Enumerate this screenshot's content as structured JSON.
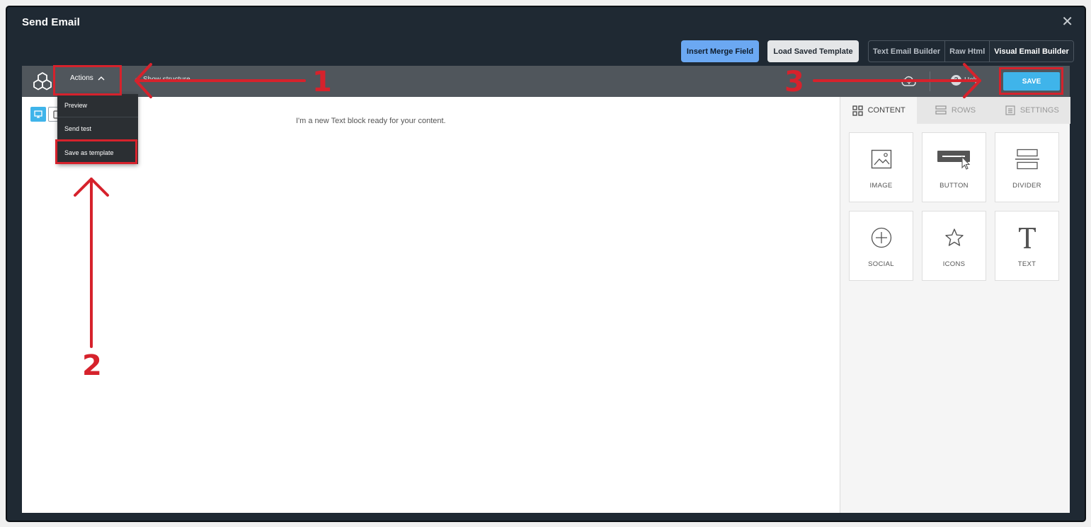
{
  "window": {
    "title": "Send Email",
    "close_glyph": "✕"
  },
  "topbar": {
    "insert_merge_field": "Insert Merge Field",
    "load_saved_template": "Load Saved Template",
    "modes": [
      "Text Email Builder",
      "Raw Html",
      "Visual Email Builder"
    ],
    "active_mode": "Visual Email Builder"
  },
  "toolbar": {
    "logo_icon": "cubes-logo-icon",
    "actions_label": "Actions",
    "show_structure_label": "Show structure",
    "help_label": "Help",
    "save_label": "SAVE"
  },
  "actions_menu": {
    "items": [
      "Preview",
      "Send test",
      "Save as template"
    ],
    "highlighted": "Save as template"
  },
  "canvas": {
    "text_block": "I'm a new Text block ready for your content.",
    "device_icons": [
      "desktop-icon",
      "mobile-icon"
    ]
  },
  "sidebar": {
    "tabs": [
      {
        "label": "CONTENT",
        "icon": "grid-icon"
      },
      {
        "label": "ROWS",
        "icon": "rows-icon"
      },
      {
        "label": "SETTINGS",
        "icon": "settings-icon"
      }
    ],
    "active_tab": "CONTENT",
    "tiles": [
      {
        "label": "IMAGE",
        "icon": "image-icon"
      },
      {
        "label": "BUTTON",
        "icon": "button-icon"
      },
      {
        "label": "DIVIDER",
        "icon": "divider-icon"
      },
      {
        "label": "SOCIAL",
        "icon": "social-plus-icon"
      },
      {
        "label": "ICONS",
        "icon": "star-icon"
      },
      {
        "label": "TEXT",
        "icon": "text-t-icon"
      }
    ]
  },
  "annotations": {
    "labels": [
      "1",
      "2",
      "3"
    ],
    "color": "#d6222c"
  },
  "colors": {
    "frame_bg": "#1f2933",
    "toolbar_bg": "#50565c",
    "accent_blue": "#3fb4ea",
    "merge_button": "#6ba8f2",
    "annotation_red": "#d6222c"
  }
}
